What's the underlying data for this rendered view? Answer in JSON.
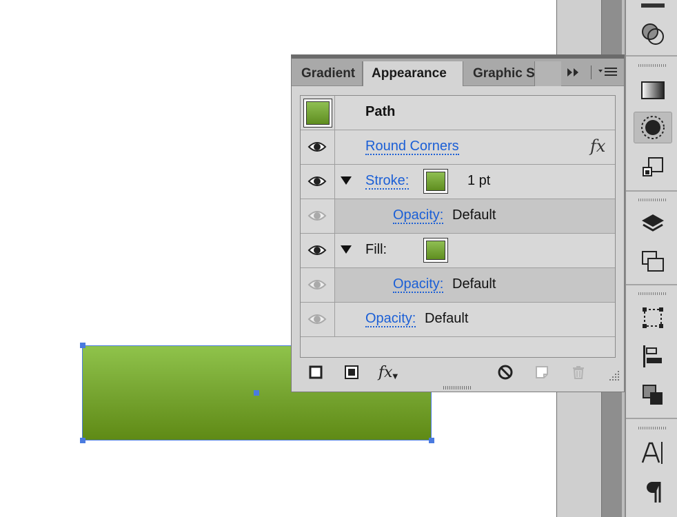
{
  "panel": {
    "tabs": [
      {
        "label": "Gradient"
      },
      {
        "label": "Appearance"
      },
      {
        "label": "Graphic Styles"
      }
    ],
    "active_tab": "Appearance",
    "object_label": "Path",
    "effect": {
      "label": "Round Corners",
      "badge": "fx"
    },
    "stroke": {
      "label": "Stroke:",
      "weight": "1 pt",
      "opacity_label": "Opacity:",
      "opacity_value": "Default"
    },
    "fill": {
      "label": "Fill:",
      "opacity_label": "Opacity:",
      "opacity_value": "Default"
    },
    "object_opacity": {
      "label": "Opacity:",
      "value": "Default"
    },
    "footer": {
      "fx_label": "fx"
    }
  },
  "colors": {
    "accent_link": "#1b5fd6",
    "selection": "#4a7be0",
    "fill_top": "#8fc34b",
    "fill_bottom": "#5f8a15"
  },
  "toolbar_icons": [
    "pathfinder-icon",
    "gradient-icon",
    "appearance-icon",
    "transform-icon",
    "layers-icon",
    "artboards-icon",
    "transform-bounds-icon",
    "align-icon",
    "pathfinder-shapes-icon",
    "character-icon",
    "paragraph-icon"
  ]
}
